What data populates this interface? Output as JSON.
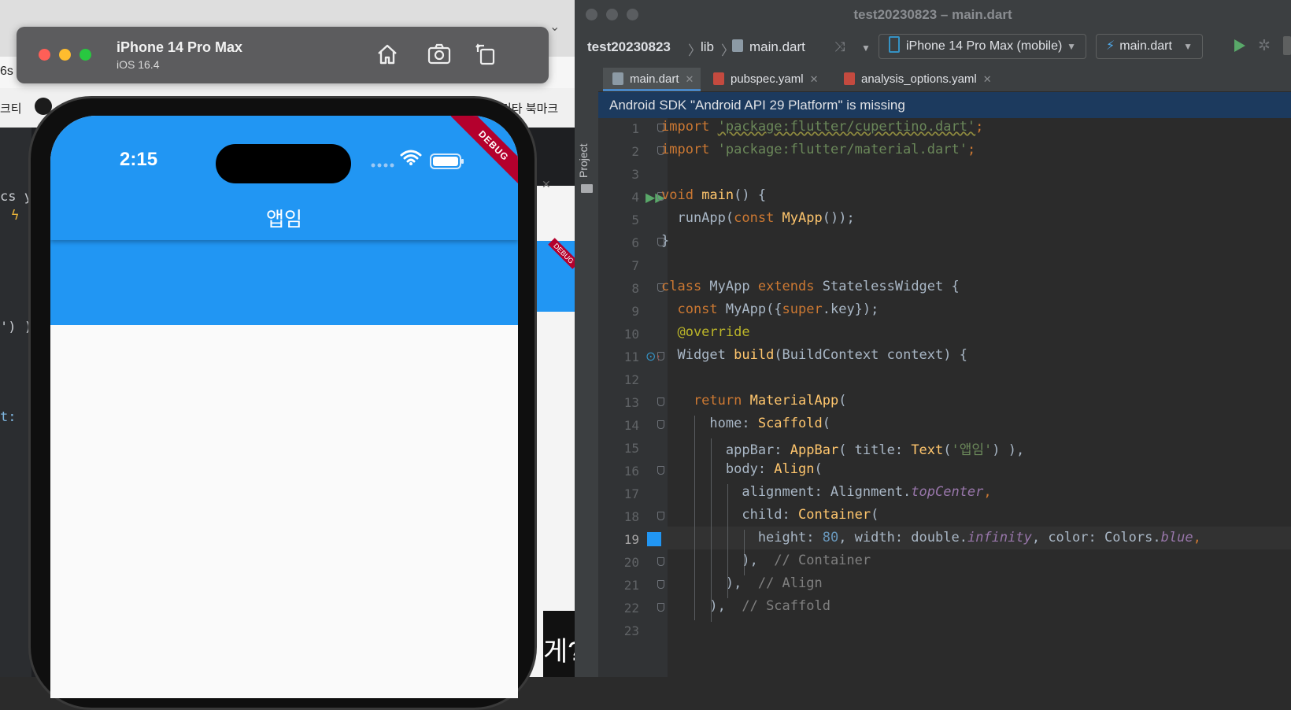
{
  "browser": {
    "frag_6s": "6s",
    "bookmark_left": "크티",
    "bookmark_right": "기타 북마크",
    "frag_cs": "cs y",
    "frag_paren": "') )",
    "frag_t": "t:",
    "frag_question": "게?",
    "debug_small": "DEBUG"
  },
  "simulator": {
    "device_name": "iPhone 14 Pro Max",
    "os_version": "iOS 16.4",
    "buttons": [
      "home-icon",
      "screenshot-icon",
      "rotate-icon"
    ]
  },
  "phone": {
    "status_time": "2:15",
    "appbar_title": "앱임",
    "debug_banner": "DEBUG",
    "colors": {
      "primary": "#2196f3",
      "background": "#fafafa"
    }
  },
  "ide": {
    "window_title": "test20230823 – main.dart",
    "breadcrumb": {
      "project": "test20230823",
      "folder": "lib",
      "file": "main.dart"
    },
    "device_selector": "iPhone 14 Pro Max (mobile)",
    "run_config": "main.dart",
    "tabs": [
      {
        "label": "main.dart",
        "active": true
      },
      {
        "label": "pubspec.yaml",
        "active": false
      },
      {
        "label": "analysis_options.yaml",
        "active": false
      }
    ],
    "side_panel_label": "Project",
    "banner": "Android SDK \"Android API 29 Platform\" is missing",
    "current_line": "19",
    "line_numbers": [
      "1",
      "2",
      "3",
      "4",
      "5",
      "6",
      "7",
      "8",
      "9",
      "10",
      "11",
      "12",
      "13",
      "14",
      "15",
      "16",
      "17",
      "18",
      "19",
      "20",
      "21",
      "22",
      "23"
    ],
    "code": {
      "l1a": "import ",
      "l1b": "'package:flutter/cupertino.dart'",
      "l1c": ";",
      "l2a": "import ",
      "l2b": "'package:flutter/material.dart'",
      "l2c": ";",
      "l4a": "void ",
      "l4b": "main",
      "l4c": "() {",
      "l5a": "  runApp(",
      "l5b": "const ",
      "l5c": "MyApp",
      "l5d": "());",
      "l6a": "}",
      "l8a": "class ",
      "l8b": "MyApp ",
      "l8c": "extends ",
      "l8d": "StatelessWidget {",
      "l9a": "  const ",
      "l9b": "MyApp({",
      "l9c": "super",
      "l9d": ".key});",
      "l10a": "  @override",
      "l11a": "  Widget ",
      "l11b": "build",
      "l11c": "(BuildContext context) {",
      "l13a": "    return ",
      "l13b": "MaterialApp",
      "l13c": "(",
      "l14a": "      home: ",
      "l14b": "Scaffold",
      "l14c": "(",
      "l15a": "        appBar: ",
      "l15b": "AppBar",
      "l15c": "( title: ",
      "l15d": "Text",
      "l15e": "(",
      "l15f": "'앱임'",
      "l15g": ") ),",
      "l16a": "        body: ",
      "l16b": "Align",
      "l16c": "(",
      "l17a": "          alignment: Alignment.",
      "l17b": "topCenter",
      "l17c": ",",
      "l18a": "          child: ",
      "l18b": "Container",
      "l18c": "(",
      "l19a": "            height: ",
      "l19b": "80",
      "l19c": ", width: double.",
      "l19d": "infinity",
      "l19e": ", color: Colors.",
      "l19f": "blue",
      "l19g": ",",
      "l20a": "          ),  ",
      "l20b": "// Container",
      "l21a": "        ),  ",
      "l21b": "// Align",
      "l22a": "      ),  ",
      "l22b": "// Scaffold"
    },
    "colors": {
      "gutter_swatch": "#2196f3",
      "run_green": "#59a869"
    }
  }
}
